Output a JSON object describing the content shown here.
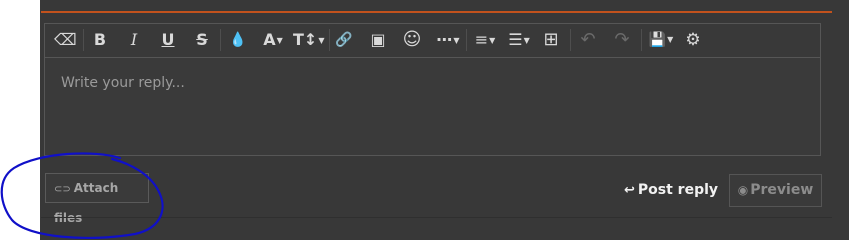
{
  "editor": {
    "placeholder": "Write your reply..."
  },
  "toolbar": {
    "buttons": [
      {
        "icon": "eraser-icon",
        "glyph": "⌫"
      },
      {
        "icon": "bold-icon",
        "glyph": "B"
      },
      {
        "icon": "italic-icon",
        "glyph": "I"
      },
      {
        "icon": "underline-icon",
        "glyph": "U"
      },
      {
        "icon": "strikethrough-icon",
        "glyph": "S"
      },
      {
        "icon": "text-color-icon",
        "glyph": "💧"
      },
      {
        "icon": "font-family-icon",
        "glyph": "A"
      },
      {
        "icon": "font-size-icon",
        "glyph": "T↕"
      },
      {
        "icon": "link-icon",
        "glyph": "🔗"
      },
      {
        "icon": "image-icon",
        "glyph": "▣"
      },
      {
        "icon": "emoji-icon",
        "glyph": "☺"
      },
      {
        "icon": "more-options-icon",
        "glyph": "⋯"
      },
      {
        "icon": "align-icon",
        "glyph": "≡"
      },
      {
        "icon": "list-icon",
        "glyph": "☰"
      },
      {
        "icon": "table-icon",
        "glyph": "⊞"
      },
      {
        "icon": "undo-icon",
        "glyph": "↶"
      },
      {
        "icon": "redo-icon",
        "glyph": "↷"
      },
      {
        "icon": "save-draft-icon",
        "glyph": "💾"
      },
      {
        "icon": "settings-icon",
        "glyph": "⚙"
      }
    ]
  },
  "actions": {
    "attach_label": "Attach files",
    "attach_icon": "paperclip-icon",
    "post_label": "Post reply",
    "post_icon": "reply-arrow-icon",
    "preview_label": "Preview",
    "preview_icon": "eye-icon"
  },
  "colors": {
    "accent": "#c2521d",
    "annotation": "#1010c8",
    "background": "#383838"
  }
}
